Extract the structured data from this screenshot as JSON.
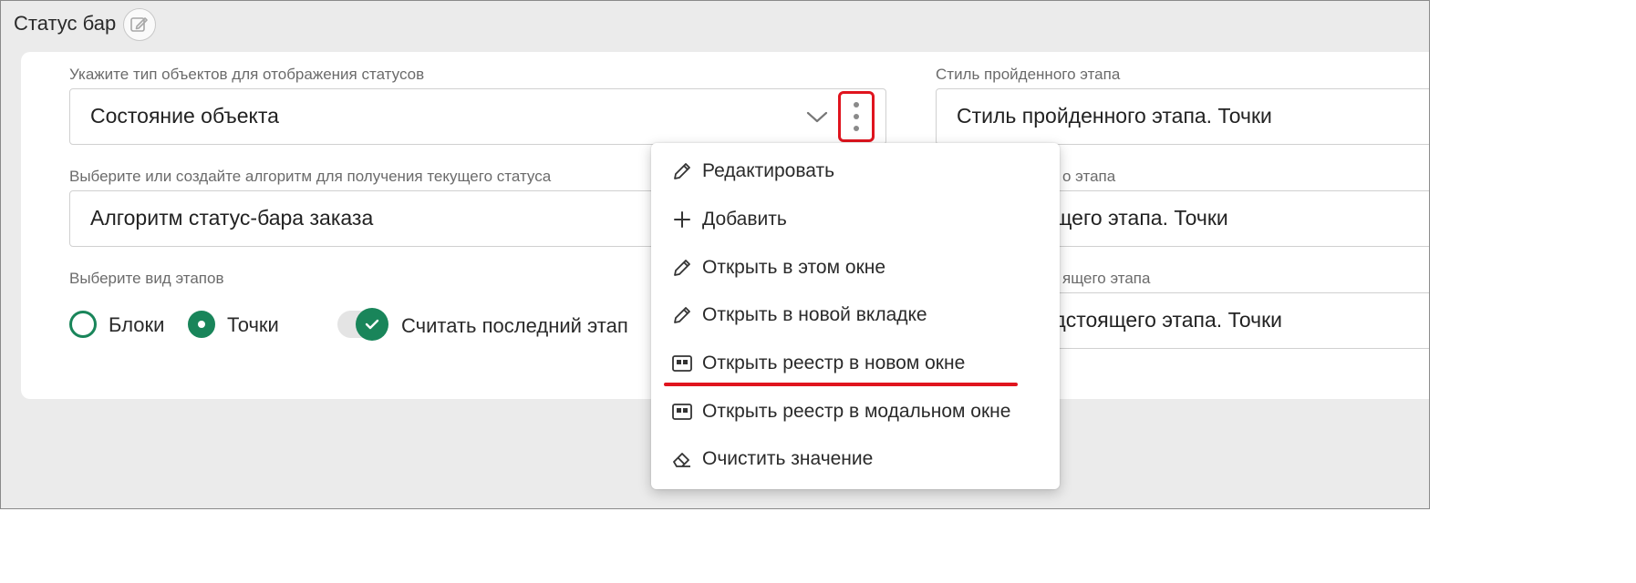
{
  "section": {
    "title": "Статус бар"
  },
  "left": {
    "object_type": {
      "label": "Укажите тип объектов для отображения статусов",
      "value": "Состояние объекта"
    },
    "algorithm": {
      "label": "Выберите или создайте алгоритм для получения текущего статуса",
      "value": "Алгоритм статус-бара заказа"
    },
    "stage_view": {
      "label": "Выберите вид этапов",
      "options": [
        {
          "label": "Блоки",
          "checked": false
        },
        {
          "label": "Точки",
          "checked": true
        }
      ]
    },
    "toggle": {
      "label": "Считать последний этап",
      "on": true
    }
  },
  "right": {
    "passed": {
      "label": "Стиль пройденного этапа",
      "value": "Стиль пройденного этапа. Точки"
    },
    "current": {
      "label_visible": "о этапа",
      "value_visible": "ущего этапа. Точки"
    },
    "upcoming": {
      "label_visible": "ящего этапа",
      "value_visible": "едстоящего этапа. Точки"
    }
  },
  "context_menu": {
    "items": [
      {
        "label": "Редактировать",
        "icon": "pencil-icon"
      },
      {
        "label": "Добавить",
        "icon": "plus-icon"
      },
      {
        "label": "Открыть в этом окне",
        "icon": "pencil-icon"
      },
      {
        "label": "Открыть в новой вкладке",
        "icon": "pencil-icon"
      },
      {
        "label": "Открыть реестр в новом окне",
        "icon": "registry-icon",
        "highlighted": true
      },
      {
        "label": "Открыть реестр в модальном окне",
        "icon": "registry-icon"
      },
      {
        "label": "Очистить значение",
        "icon": "eraser-icon"
      }
    ]
  },
  "colors": {
    "accent_green": "#19855a",
    "highlight_red": "#e0141e"
  }
}
